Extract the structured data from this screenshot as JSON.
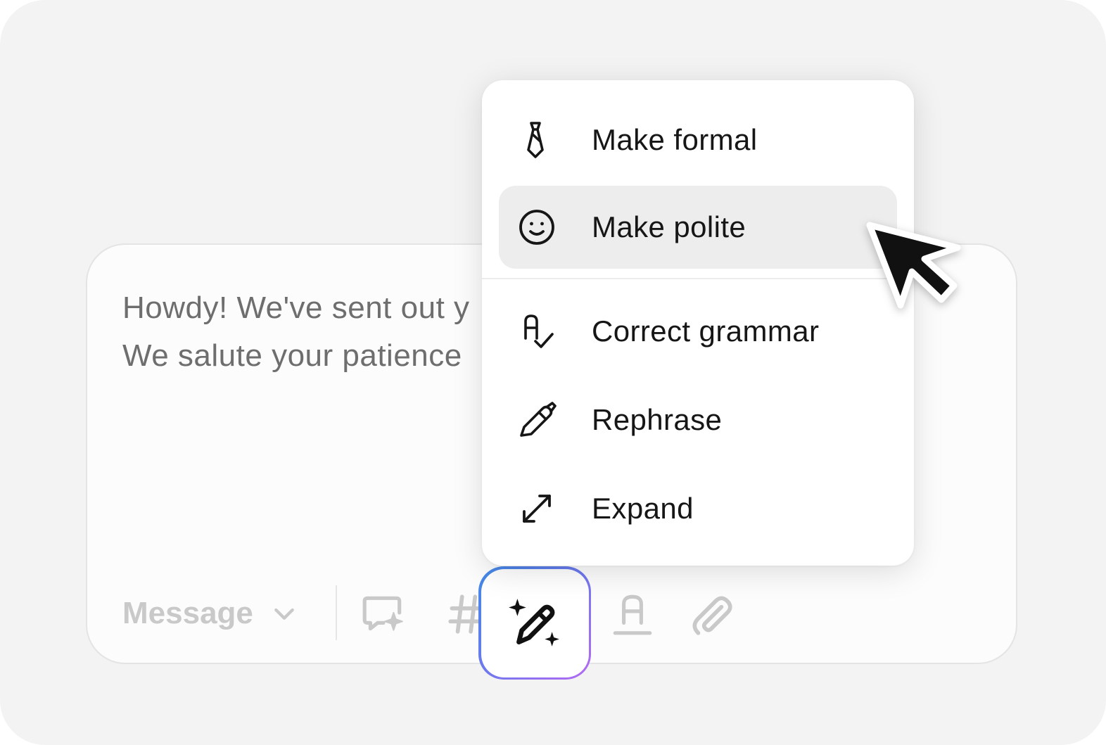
{
  "composer": {
    "text_lines": [
      "Howdy! We've sent out y",
      "We salute your patience"
    ],
    "message_type": "Message"
  },
  "toolbar": {
    "icons": [
      "ai-reply-icon",
      "hashtag-icon",
      "ai-edit-icon",
      "text-format-icon",
      "attachment-icon"
    ]
  },
  "menu": {
    "items": [
      {
        "label": "Make formal",
        "icon": "tie-icon",
        "active": false
      },
      {
        "label": "Make polite",
        "icon": "smile-icon",
        "active": true
      },
      {
        "label": "Correct grammar",
        "icon": "grammar-check-icon",
        "active": false
      },
      {
        "label": "Rephrase",
        "icon": "pencil-icon",
        "active": false
      },
      {
        "label": "Expand",
        "icon": "expand-arrows-icon",
        "active": false
      }
    ]
  },
  "colors": {
    "canvas_bg": "#f3f3f3",
    "menu_active_bg": "#ededed",
    "ai_gradient_start": "#3f8ae6",
    "ai_gradient_end": "#b56af3",
    "text_muted": "#6e6e6e",
    "icon_muted": "#c9c9c9"
  }
}
